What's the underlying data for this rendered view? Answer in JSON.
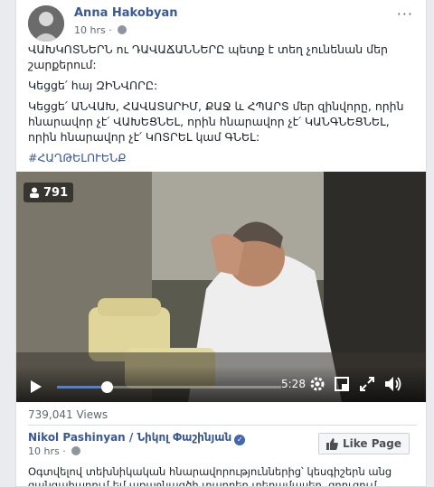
{
  "post": {
    "author": "Anna Hakobyan",
    "time": "10 hrs",
    "more_label": "···",
    "paragraphs": [
      "ՎԱԽԿՈՏՆԵՐՆ ու ԴԱՎԱՃԱՆՆԵՐԸ պետք է տեղ չունենան մեր շարքերում:",
      "Կեցցե՛ հայ ԶԻՆՎՈՐԸ:",
      "Կեցցե՛ ԱՆՎԱԽ, ՀԱՎԱՏԱՐԻՄ, ՔԱՋ և ՀՊԱՐՏ մեր զինվորը, որին հնարավոր չէ՛ ՎԱԽԵՑՆԵԼ, որին հնարավոր չէ՛ ԿԱՆԳՆԵՑՆԵԼ, որին հնարավոր չէ՛ ԿՈՏՐԵԼ կամ ԳՆԵԼ:"
    ],
    "hashtag": "#ՀԱՂԹԵԼՈՒԵՆՔ"
  },
  "video": {
    "viewer_count": "791",
    "duration": "5:28",
    "progress": 0.22
  },
  "stats": {
    "views": "739,041 Views"
  },
  "shared_page": {
    "name": "Nikol Pashinyan / Նիկոլ Փաշինյան",
    "time": "10 hrs",
    "like_button": "Like Page",
    "text": "Օգտվելով տեխնիկական հնարավորություններից՝ կեսգիշերն անց զանգահարում եմ առաջնագծի տարբեր տեղամասեր, զրուցում հրամանատարների, զինվորների"
  },
  "colors": {
    "link": "#385898",
    "progress": "#4080ff",
    "background": "#e9ebee"
  }
}
